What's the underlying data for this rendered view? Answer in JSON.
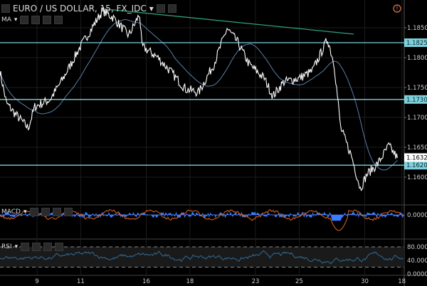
{
  "header": {
    "symbol": "EURO / US DOLLAR, 15, FX_IDC",
    "indicator": "MA",
    "macd_label": "MACD",
    "rsi_label": "RSI"
  },
  "colors": {
    "price": "#ffffff",
    "ma": "#5a7fa8",
    "hline": "#7fd0dc",
    "trend": "#2e9e80",
    "macd": "#3a7bff",
    "signal": "#e0661e",
    "rsi": "#2f6c99",
    "alert": "#e07a50"
  },
  "chart_data": {
    "type": "line",
    "title": "EURO / US DOLLAR, 15, FX_IDC",
    "x_unit": "trading days from the 9th",
    "xticks": [
      {
        "t": 0,
        "label": "9"
      },
      {
        "t": 2,
        "label": "11"
      },
      {
        "t": 5,
        "label": "16"
      },
      {
        "t": 7,
        "label": "18"
      },
      {
        "t": 10,
        "label": "23"
      },
      {
        "t": 12,
        "label": "25"
      },
      {
        "t": 15,
        "label": "30"
      },
      {
        "t": 16.7,
        "label": "18"
      }
    ],
    "price_ticks": [
      "1.18500",
      "1.18000",
      "1.17500",
      "1.17000",
      "1.16500",
      "1.16000"
    ],
    "price_tick_values": [
      1.185,
      1.18,
      1.175,
      1.17,
      1.165,
      1.16
    ],
    "ylim": [
      1.1542,
      1.1896
    ],
    "last_price": "1.16328",
    "horizontal_levels": [
      {
        "value": 1.1825,
        "label": "1.18250"
      },
      {
        "value": 1.173,
        "label": "1.17300"
      },
      {
        "value": 1.162,
        "label": "1.16200"
      }
    ],
    "trendline": [
      [
        3.2,
        1.1881
      ],
      [
        14.5,
        1.18393
      ]
    ],
    "series": [
      {
        "name": "EURUSD",
        "points": [
          [
            -1.7,
            1.17774
          ],
          [
            -1.4,
            1.17238
          ],
          [
            -1.0,
            1.1706
          ],
          [
            -0.4,
            1.16821
          ],
          [
            -0.1,
            1.17179
          ],
          [
            0.6,
            1.17298
          ],
          [
            1.2,
            1.17655
          ],
          [
            1.9,
            1.18131
          ],
          [
            2.5,
            1.18488
          ],
          [
            3.0,
            1.18786
          ],
          [
            3.5,
            1.18667
          ],
          [
            4.2,
            1.18369
          ],
          [
            4.7,
            1.18726
          ],
          [
            4.8,
            1.1819
          ],
          [
            5.5,
            1.18012
          ],
          [
            6.1,
            1.17774
          ],
          [
            6.8,
            1.17476
          ],
          [
            7.4,
            1.17417
          ],
          [
            8.1,
            1.17893
          ],
          [
            8.7,
            1.18488
          ],
          [
            9.2,
            1.1825
          ],
          [
            9.7,
            1.17893
          ],
          [
            10.4,
            1.17655
          ],
          [
            10.8,
            1.17357
          ],
          [
            11.3,
            1.17595
          ],
          [
            12.0,
            1.17655
          ],
          [
            12.6,
            1.17774
          ],
          [
            13.3,
            1.1831
          ],
          [
            13.6,
            1.17893
          ],
          [
            13.9,
            1.16821
          ],
          [
            14.4,
            1.16345
          ],
          [
            14.8,
            1.1581
          ],
          [
            15.1,
            1.16048
          ],
          [
            15.6,
            1.16226
          ],
          [
            16.1,
            1.16524
          ],
          [
            16.5,
            1.16321
          ]
        ]
      }
    ],
    "macd": {
      "ticks": [
        "0.0000"
      ]
    },
    "rsi": {
      "ticks": [
        "80.0000",
        "40.0000",
        "0.0000"
      ],
      "bands": [
        70,
        30
      ]
    }
  }
}
